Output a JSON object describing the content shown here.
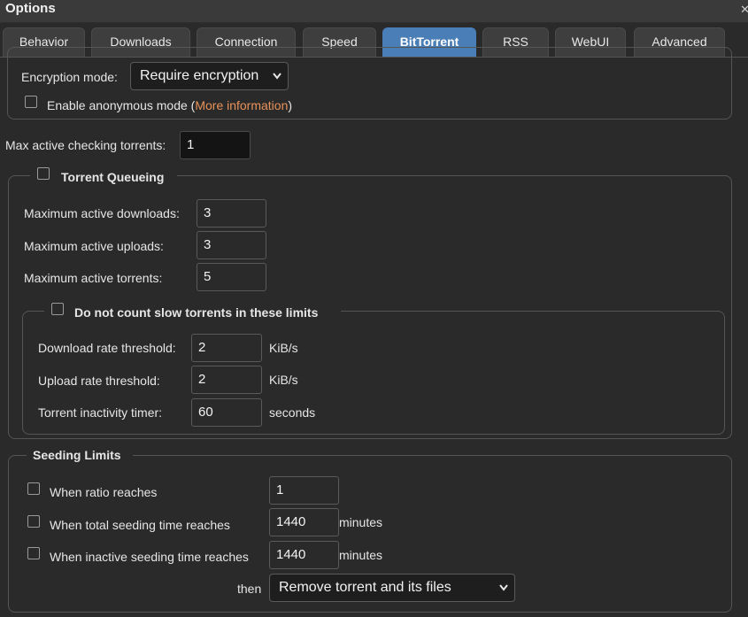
{
  "window": {
    "title": "Options"
  },
  "tabs": [
    {
      "label": "Behavior"
    },
    {
      "label": "Downloads"
    },
    {
      "label": "Connection"
    },
    {
      "label": "Speed"
    },
    {
      "label": "BitTorrent"
    },
    {
      "label": "RSS"
    },
    {
      "label": "WebUI"
    },
    {
      "label": "Advanced"
    }
  ],
  "privacy": {
    "encryption_label": "Encryption mode:",
    "encryption_value": "Require encryption",
    "anonymous_label_before": "Enable anonymous mode (",
    "anonymous_link": "More information",
    "anonymous_label_after": ")"
  },
  "checking": {
    "label": "Max active checking torrents:",
    "value": "1"
  },
  "queueing": {
    "legend": "Torrent Queueing",
    "max_downloads_label": "Maximum active downloads:",
    "max_downloads_value": "3",
    "max_uploads_label": "Maximum active uploads:",
    "max_uploads_value": "3",
    "max_torrents_label": "Maximum active torrents:",
    "max_torrents_value": "5",
    "slow": {
      "legend": "Do not count slow torrents in these limits",
      "download_label": "Download rate threshold:",
      "download_value": "2",
      "download_unit": "KiB/s",
      "upload_label": "Upload rate threshold:",
      "upload_value": "2",
      "upload_unit": "KiB/s",
      "inactivity_label": "Torrent inactivity timer:",
      "inactivity_value": "60",
      "inactivity_unit": "seconds"
    }
  },
  "seeding": {
    "legend": "Seeding Limits",
    "ratio_label": "When ratio reaches",
    "ratio_value": "1",
    "time_label": "When total seeding time reaches",
    "time_value": "1440",
    "time_unit": "minutes",
    "inactive_label": "When inactive seeding time reaches",
    "inactive_value": "1440",
    "inactive_unit": "minutes",
    "then_label": "then",
    "action_value": "Remove torrent and its files"
  }
}
